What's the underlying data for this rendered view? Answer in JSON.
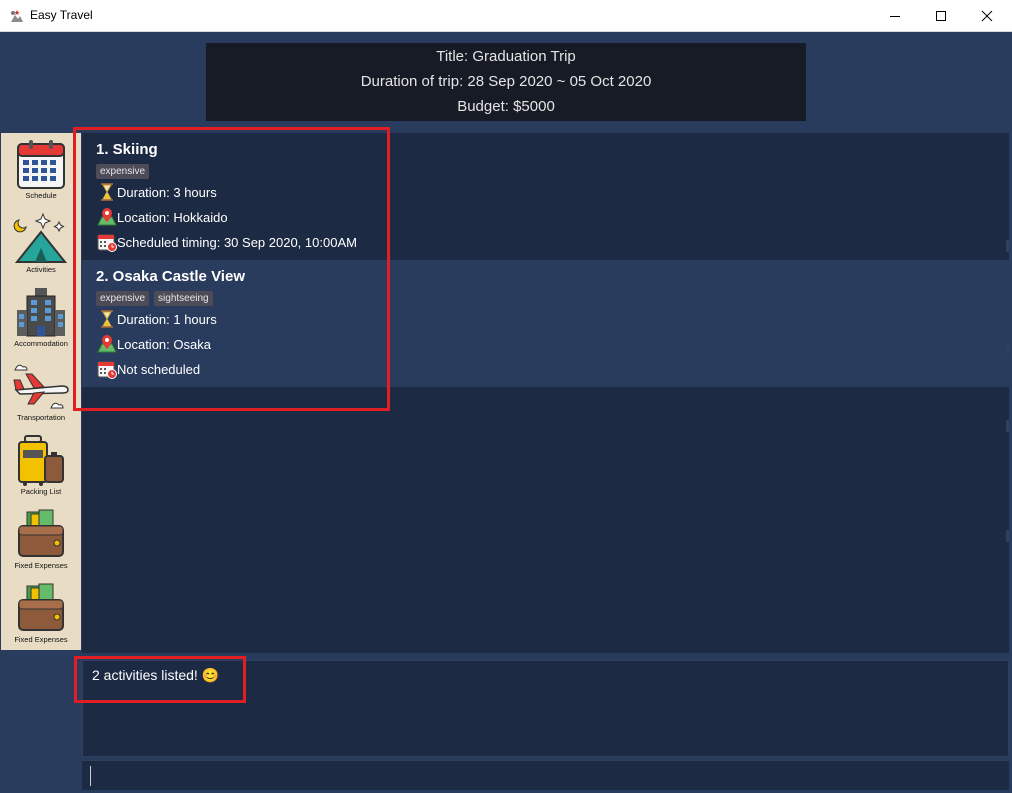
{
  "window": {
    "title": "Easy Travel",
    "controls": [
      "minimize",
      "maximize",
      "close"
    ]
  },
  "trip": {
    "title_line": "Title: Graduation Trip",
    "duration_line": "Duration of trip: 28 Sep 2020 ~ 05 Oct 2020",
    "budget_line": "Budget: $5000"
  },
  "sidebar": {
    "items": [
      {
        "label": "Schedule",
        "icon": "calendar-icon"
      },
      {
        "label": "Activities",
        "icon": "tent-icon"
      },
      {
        "label": "Accommodation",
        "icon": "hotel-icon"
      },
      {
        "label": "Transportation",
        "icon": "airplane-icon"
      },
      {
        "label": "Packing List",
        "icon": "luggage-icon"
      },
      {
        "label": "Fixed Expenses",
        "icon": "wallet-icon"
      },
      {
        "label": "Fixed Expenses",
        "icon": "wallet-icon"
      }
    ]
  },
  "activities": [
    {
      "title": "1.  Skiing",
      "tags": [
        "expensive"
      ],
      "duration": "Duration: 3 hours",
      "location": "Location: Hokkaido",
      "schedule": "Scheduled timing: 30 Sep 2020, 10:00AM"
    },
    {
      "title": "2.  Osaka Castle View",
      "tags": [
        "expensive",
        "sightseeing"
      ],
      "duration": "Duration: 1 hours",
      "location": "Location: Osaka",
      "schedule": "Not scheduled"
    }
  ],
  "result": {
    "message": "2 activities listed! 😊"
  },
  "command": {
    "value": ""
  },
  "colors": {
    "background": "#2a3c5e",
    "panel": "#1c2a44",
    "sidebar": "#e8dcc5",
    "header": "#161b26",
    "highlight": "#e01e24",
    "tag": "#4d4b58"
  }
}
